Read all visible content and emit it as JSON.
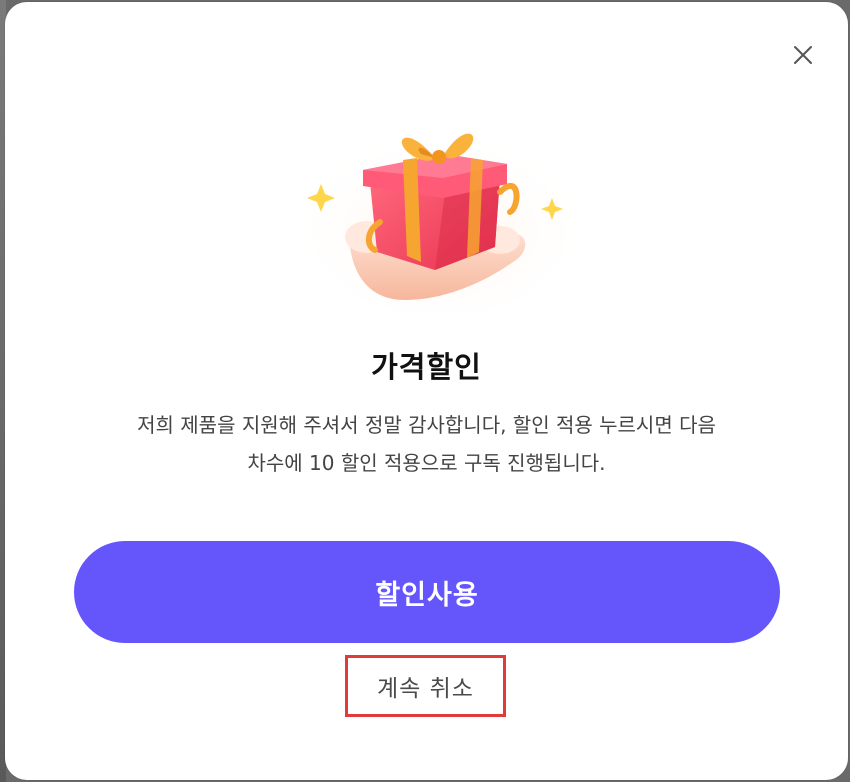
{
  "dialog": {
    "title": "가격할인",
    "description_line1": "저희 제품을 지원해 주셔서 정말 감사합니다, 할인 적용 누르시면 다음",
    "description_line2": "차수에 10 할인 적용으로 구독 진행됩니다.",
    "primary_button_label": "할인사용",
    "cancel_button_label": "계속 취소",
    "close_icon": "close-icon",
    "illustration_icon": "gift-box-in-hand-icon"
  },
  "colors": {
    "primary": "#6556fb",
    "highlight_border": "#e03a3a",
    "title_text": "#111111",
    "body_text": "#444444"
  }
}
